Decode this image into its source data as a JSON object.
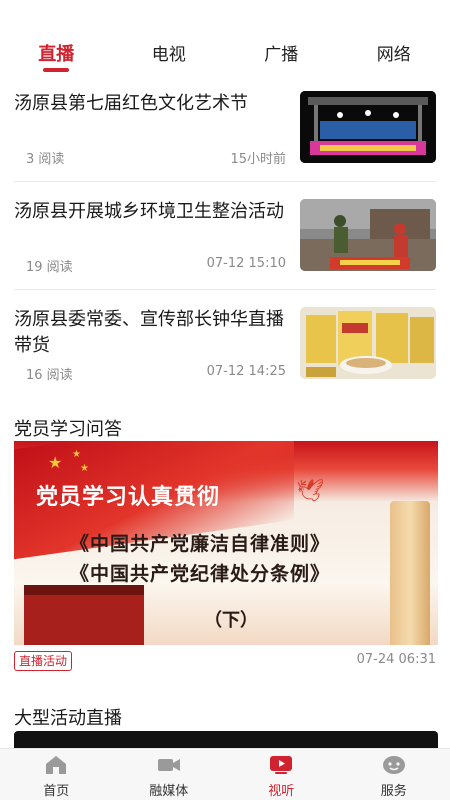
{
  "tabs": [
    {
      "label": "直播",
      "active": true
    },
    {
      "label": "电视",
      "active": false
    },
    {
      "label": "广播",
      "active": false
    },
    {
      "label": "网络",
      "active": false
    }
  ],
  "news": [
    {
      "title": "汤原县第七届红色文化艺术节",
      "reads": "3 阅读",
      "time": "15小时前"
    },
    {
      "title": "汤原县开展城乡环境卫生整治活动",
      "reads": "19 阅读",
      "time": "07-12 15:10"
    },
    {
      "title": "汤原县委常委、宣传部长钟华直播带货",
      "reads": "16 阅读",
      "time": "07-12 14:25"
    }
  ],
  "section1": {
    "title": "党员学习问答",
    "banner_headline": "党员学习认真贯彻",
    "banner_line1": "《中国共产党廉洁自律准则》",
    "banner_line2": "《中国共产党纪律处分条例》",
    "banner_part": "（下）",
    "tag": "直播活动",
    "time": "07-24 06:31"
  },
  "section2": {
    "title": "大型活动直播"
  },
  "bottom_nav": [
    {
      "label": "首页",
      "icon": "home-icon",
      "active": false
    },
    {
      "label": "融媒体",
      "icon": "video-camera-icon",
      "active": false
    },
    {
      "label": "视听",
      "icon": "play-tv-icon",
      "active": true
    },
    {
      "label": "服务",
      "icon": "service-icon",
      "active": false
    }
  ],
  "colors": {
    "accent": "#d1232f",
    "text": "#1a1a1a",
    "muted": "#8a8a8a"
  }
}
